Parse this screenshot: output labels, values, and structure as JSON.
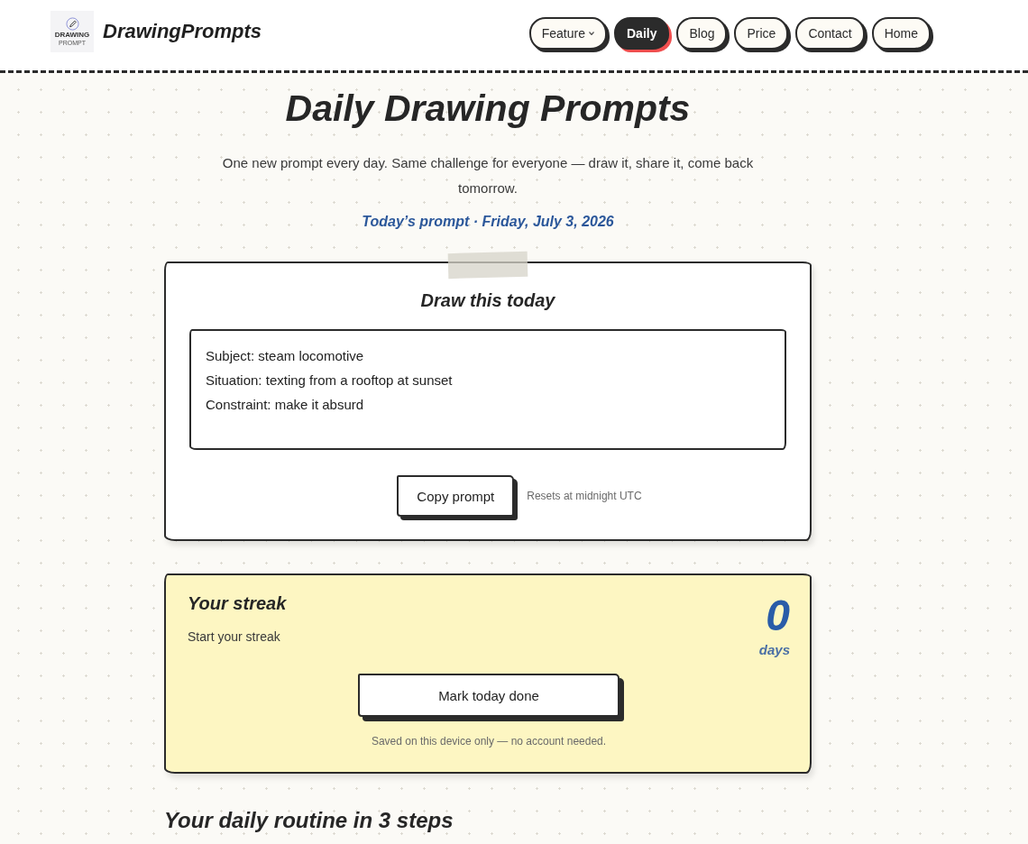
{
  "header": {
    "logo": {
      "lines": [
        "DRAWING",
        "PROMPT"
      ]
    },
    "brand": "DrawingPrompts",
    "nav": [
      {
        "label": "Feature",
        "kind": "menu",
        "selected": false
      },
      {
        "label": "Daily",
        "kind": "link",
        "selected": true
      },
      {
        "label": "Blog",
        "kind": "link",
        "selected": false
      },
      {
        "label": "Price",
        "kind": "link",
        "selected": false
      },
      {
        "label": "Contact",
        "kind": "link",
        "selected": false
      },
      {
        "label": "Home",
        "kind": "link",
        "selected": false
      }
    ]
  },
  "hero": {
    "title": "Daily Drawing Prompts",
    "subtitle": "One new prompt every day. Same challenge for everyone — draw it, share it, come back tomorrow.",
    "date_line": "Today’s prompt · Friday, July 3, 2026"
  },
  "prompt_card": {
    "heading": "Draw this today",
    "lines": [
      "Subject: steam locomotive",
      "Situation: texting from a rooftop at sunset",
      "Constraint: make it absurd"
    ],
    "button": "Copy prompt",
    "note": "Resets at midnight UTC"
  },
  "streak_card": {
    "heading": "Your streak",
    "status": "Start your streak",
    "count": "0",
    "unit": "days",
    "button": "Mark today done",
    "note": "Saved on this device only — no account needed."
  },
  "routine": {
    "heading": "Your daily routine in 3 steps"
  }
}
